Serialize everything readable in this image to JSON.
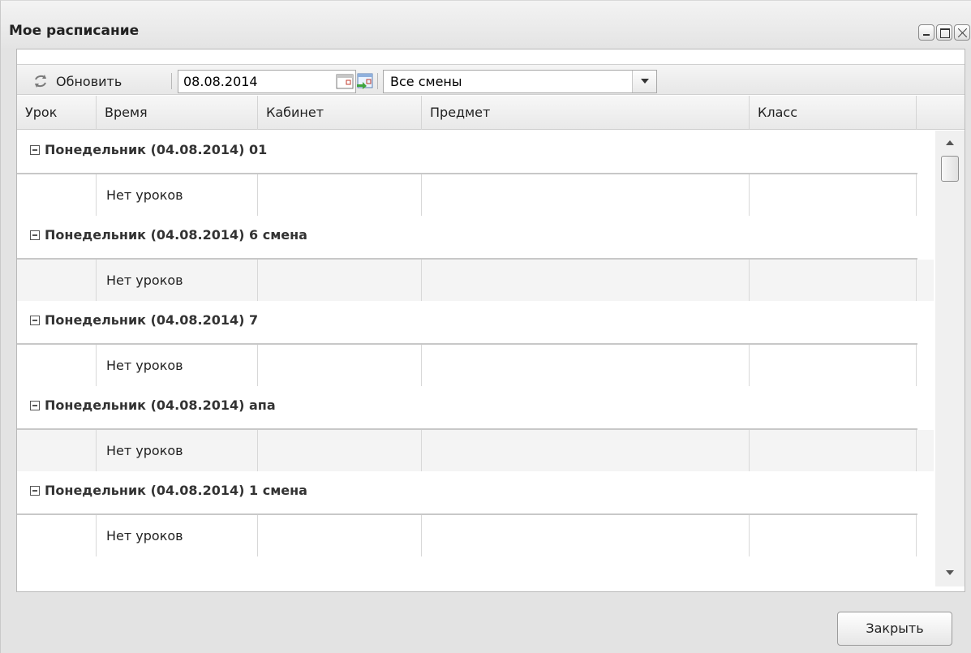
{
  "window": {
    "title": "Мое расписание"
  },
  "toolbar": {
    "refresh_label": "Обновить",
    "date_value": "08.08.2014",
    "shift_selected": "Все смены"
  },
  "grid": {
    "columns": [
      "Урок",
      "Время",
      "Кабинет",
      "Предмет",
      "Класс"
    ],
    "groups": [
      {
        "title": "Понедельник (04.08.2014) 01",
        "row_text": "Нет уроков"
      },
      {
        "title": "Понедельник (04.08.2014) 6 смена",
        "row_text": "Нет уроков"
      },
      {
        "title": "Понедельник (04.08.2014) 7",
        "row_text": "Нет уроков"
      },
      {
        "title": "Понедельник (04.08.2014) апа",
        "row_text": "Нет уроков"
      },
      {
        "title": "Понедельник (04.08.2014) 1 смена",
        "row_text": "Нет уроков"
      }
    ]
  },
  "footer": {
    "close_label": "Закрыть"
  },
  "icons": {
    "refresh": "refresh-icon",
    "calendar": "calendar-icon",
    "today": "today-icon",
    "collapse": "collapse-icon"
  }
}
